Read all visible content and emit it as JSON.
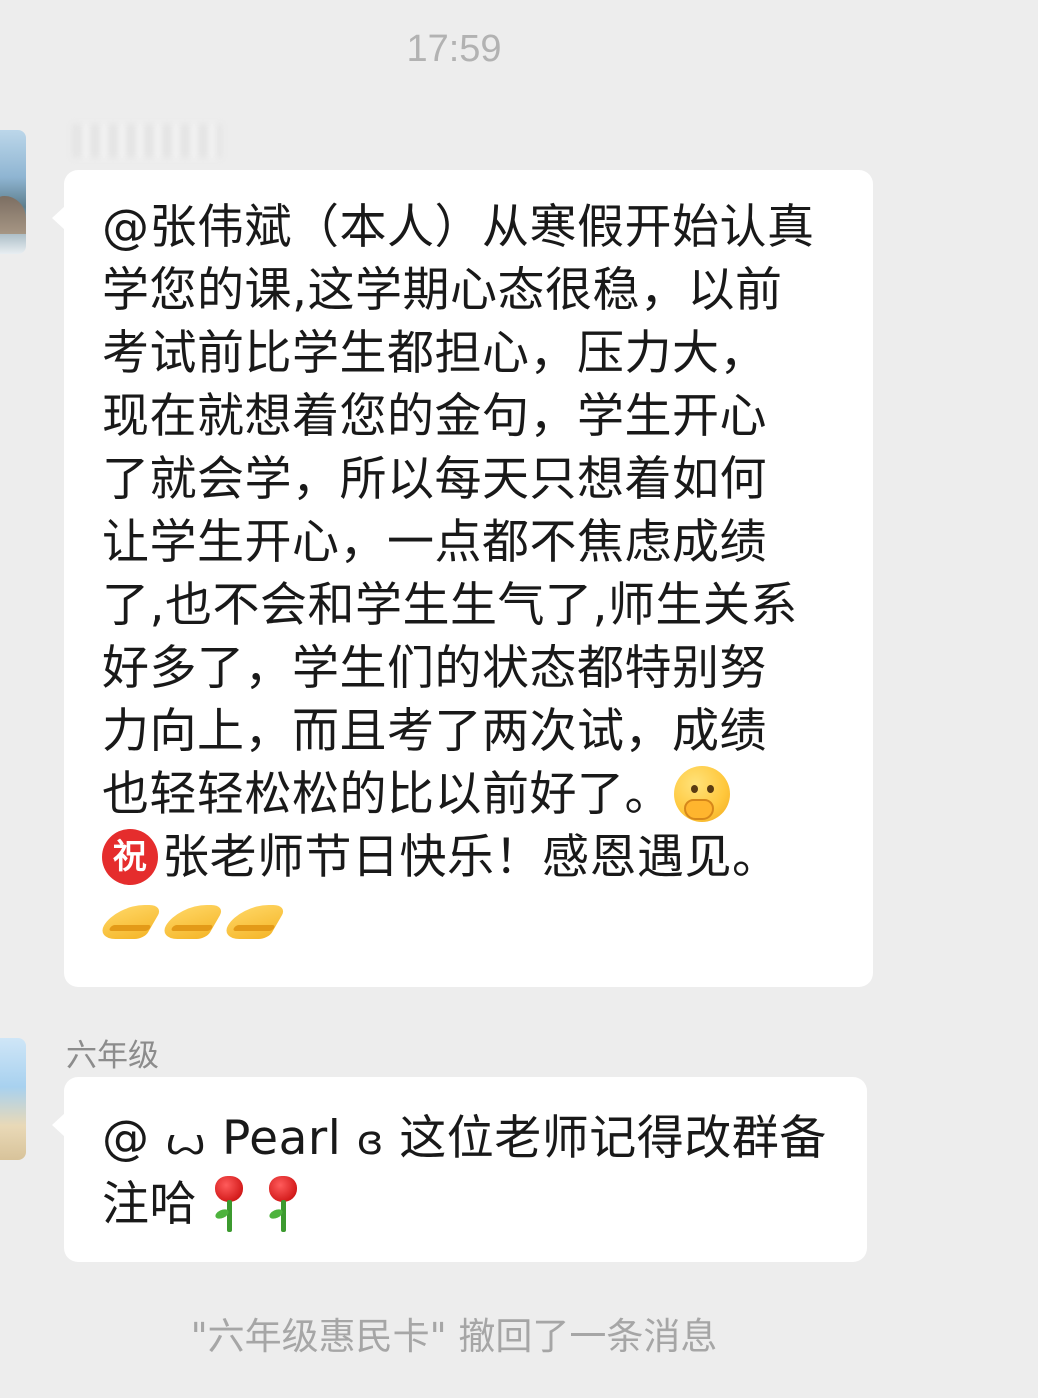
{
  "status": {
    "time": "17:59"
  },
  "messages": [
    {
      "sender": "",
      "lines": [
        "@张伟斌（本人）从寒假开始认真",
        "学您的课,这学期心态很稳，以前",
        "考试前比学生都担心，压力大，",
        "现在就想着您的金句，学生开心",
        "了就会学，所以每天只想着如何",
        "让学生开心，一点都不焦虑成绩",
        "了,也不会和学生生气了,师生关系",
        "好多了，学生们的状态都特别努",
        "力向上，而且考了两次试，成绩",
        "也轻轻松松的比以前好了。"
      ],
      "closing_line": "张老师节日快乐！感恩遇见。",
      "zhu_char": "祝",
      "emojis": [
        "thinking-face",
        "zhu-emoji",
        "folded-hands",
        "folded-hands",
        "folded-hands"
      ]
    },
    {
      "sender": "六年级",
      "prefix": "@ ",
      "symbol_left": "ꙍ",
      "mention_name": " Pearl ",
      "symbol_right": "ɞ",
      "line1_rest": " 这位老师记得改群备",
      "line2": "注哈",
      "emojis": [
        "rose",
        "rose"
      ]
    }
  ],
  "system_notice": "\"六年级惠民卡\" 撤回了一条消息",
  "colors": {
    "background": "#ededed",
    "bubble": "#ffffff",
    "text": "#191919",
    "meta_text": "#b2b2b2"
  }
}
